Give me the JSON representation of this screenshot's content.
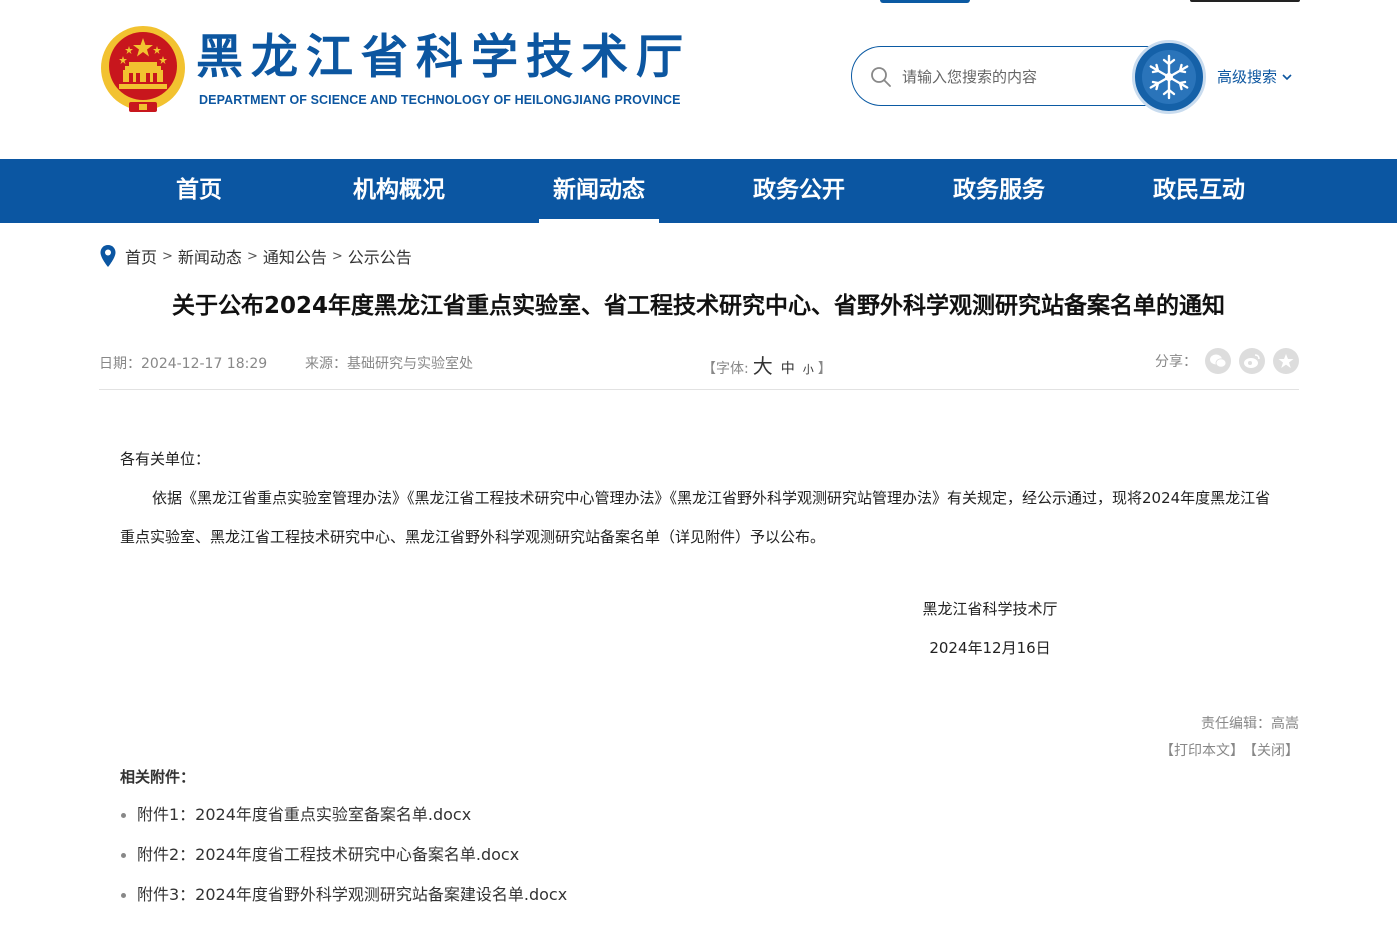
{
  "header": {
    "title": "黑龙江省科学技术厅",
    "subtitle": "DEPARTMENT OF SCIENCE AND TECHNOLOGY OF HEILONGJIANG PROVINCE",
    "search_placeholder": "请输入您搜索的内容",
    "advanced_search": "高级搜索"
  },
  "nav": {
    "items": [
      {
        "label": "首页"
      },
      {
        "label": "机构概况"
      },
      {
        "label": "新闻动态",
        "active": true
      },
      {
        "label": "政务公开"
      },
      {
        "label": "政务服务"
      },
      {
        "label": "政民互动"
      }
    ]
  },
  "breadcrumb": {
    "items": [
      "首页",
      "新闻动态",
      "通知公告",
      "公示公告"
    ],
    "separator": ">"
  },
  "article": {
    "title": "关于公布2024年度黑龙江省重点实验室、省工程技术研究中心、省野外科学观测研究站备案名单的通知",
    "date": "日期：2024-12-17 18:29",
    "source": "来源：基础研究与实验室处",
    "font_label": "【字体:",
    "font_large": "大",
    "font_medium": "中",
    "font_small": "小",
    "font_close": "】",
    "share_label": "分享：",
    "salutation": "各有关单位：",
    "body": "依据《黑龙江省重点实验室管理办法》《黑龙江省工程技术研究中心管理办法》《黑龙江省野外科学观测研究站管理办法》有关规定，经公示通过，现将2024年度黑龙江省重点实验室、黑龙江省工程技术研究中心、黑龙江省野外科学观测研究站备案名单（详见附件）予以公布。",
    "signature": "黑龙江省科学技术厅",
    "sign_date": "2024年12月16日",
    "editor": "责任编辑：高嵩",
    "print": "【打印本文】",
    "close": "【关闭】"
  },
  "attachments": {
    "title": "相关附件：",
    "items": [
      "附件1：2024年度省重点实验室备案名单.docx",
      "附件2：2024年度省工程技术研究中心备案名单.docx",
      "附件3：2024年度省野外科学观测研究站备案建设名单.docx"
    ]
  },
  "colors": {
    "brand": "#0b56a2",
    "emblem_red": "#c8161d",
    "emblem_gold": "#f2c230"
  },
  "icons": [
    "national-emblem-icon",
    "search-icon",
    "snowflake-icon",
    "chevron-down-icon",
    "location-pin-icon",
    "wechat-icon",
    "weibo-icon",
    "favorite-icon"
  ]
}
